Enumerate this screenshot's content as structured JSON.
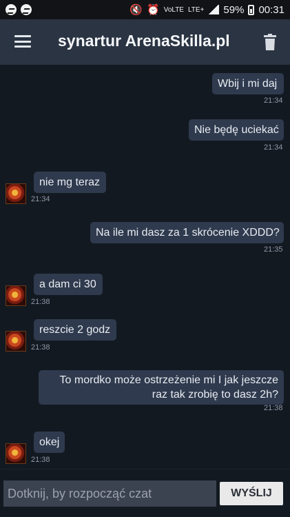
{
  "status_bar": {
    "left_icons": [
      "messenger-icon",
      "messenger-icon"
    ],
    "volte_label": "VoLTE",
    "network_label": "LTE+",
    "battery": "59%",
    "time": "00:31"
  },
  "header": {
    "title": "synartur ArenaSkilla.pl",
    "menu_icon": "hamburger-menu-icon",
    "delete_icon": "trash-icon"
  },
  "messages": [
    {
      "direction": "outgoing",
      "text": "Wbij i mi daj",
      "time": "21:34"
    },
    {
      "direction": "outgoing",
      "text": "Nie będę uciekać",
      "time": "21:34"
    },
    {
      "direction": "incoming",
      "text": "nie mg teraz",
      "time": "21:34"
    },
    {
      "direction": "outgoing",
      "text": "Na ile mi dasz za 1 skrócenie XDDD?",
      "time": "21:35"
    },
    {
      "direction": "incoming",
      "text": "a dam ci 30",
      "time": "21:38"
    },
    {
      "direction": "incoming",
      "text": "reszcie 2 godz",
      "time": "21:38"
    },
    {
      "direction": "outgoing",
      "text": "To mordko może ostrzeżenie mi I jak jeszcze raz tak zrobię to dasz 2h?",
      "time": "21:38"
    },
    {
      "direction": "incoming",
      "text": "okej",
      "time": "21:38"
    }
  ],
  "composer": {
    "placeholder": "Dotknij, by rozpocząć czat",
    "value": "",
    "send_label": "WYŚLIJ"
  },
  "colors": {
    "background": "#121921",
    "header": "#2a3442",
    "bubble": "#2f3a4e",
    "timestamp": "#8f98a6"
  }
}
